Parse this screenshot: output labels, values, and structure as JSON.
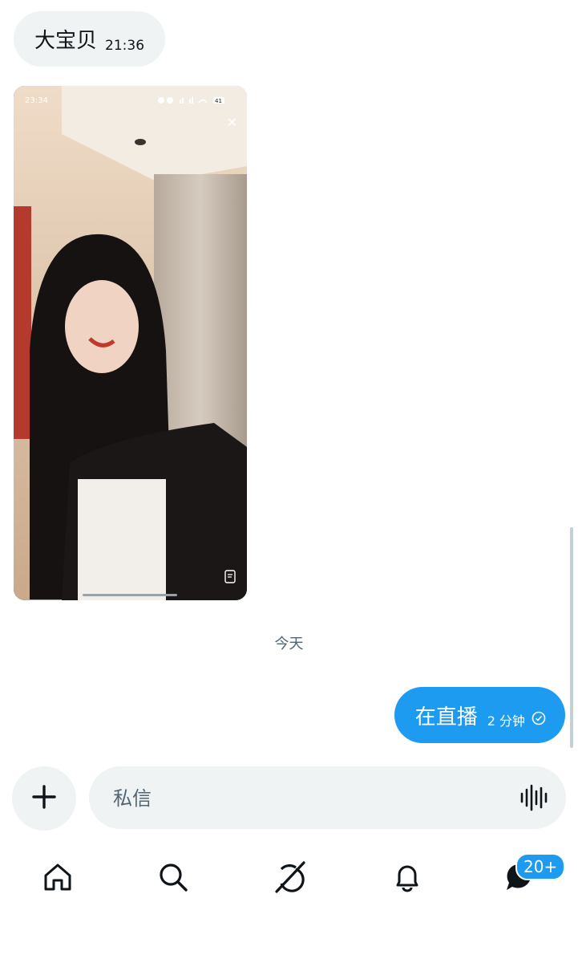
{
  "conversation": {
    "incoming_message": {
      "text": "大宝贝",
      "time": "21:36"
    },
    "shared_screenshot": {
      "status_time": "23:34",
      "battery": "41"
    },
    "day_separator": "今天",
    "outgoing_message": {
      "text": "在直播",
      "time": "2 分钟",
      "status_icon": "sent-check-icon"
    }
  },
  "composer": {
    "placeholder": "私信",
    "add_icon": "plus-icon",
    "voice_icon": "voice-waveform-icon"
  },
  "tabbar": {
    "items": [
      {
        "icon": "home-icon"
      },
      {
        "icon": "search-icon"
      },
      {
        "icon": "grok-icon"
      },
      {
        "icon": "notifications-bell-icon"
      },
      {
        "icon": "messages-icon",
        "badge": "20+"
      }
    ]
  },
  "colors": {
    "accent": "#1d9bf0",
    "bubble_gray": "#eff3f4",
    "muted_text": "#536471"
  }
}
